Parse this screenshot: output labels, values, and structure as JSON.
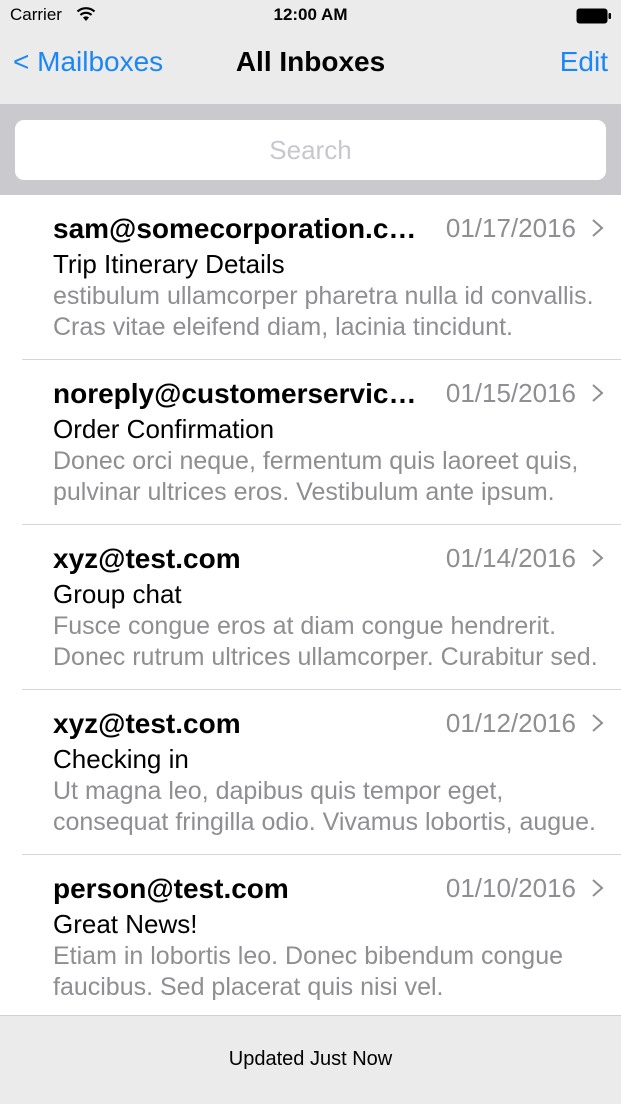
{
  "status_bar": {
    "carrier": "Carrier",
    "time": "12:00 AM",
    "wifi_icon": "wifi-icon",
    "battery_icon": "battery-icon"
  },
  "nav": {
    "back_label": "< Mailboxes",
    "title": "All Inboxes",
    "edit_label": "Edit",
    "accent_color": "#1a87f5"
  },
  "search": {
    "placeholder": "Search",
    "value": ""
  },
  "messages": [
    {
      "sender": "sam@somecorporation.com",
      "date": "01/17/2016",
      "subject": "Trip Itinerary Details",
      "preview": "estibulum ullamcorper pharetra nulla id convallis. Cras vitae eleifend diam, lacinia tincidunt."
    },
    {
      "sender": "noreply@customerservice.com",
      "date": "01/15/2016",
      "subject": "Order Confirmation",
      "preview": "Donec orci neque, fermentum quis laoreet quis, pulvinar ultrices eros. Vestibulum ante ipsum."
    },
    {
      "sender": "xyz@test.com",
      "date": "01/14/2016",
      "subject": "Group chat",
      "preview": "Fusce congue eros at diam congue hendrerit. Donec rutrum ultrices ullamcorper. Curabitur sed."
    },
    {
      "sender": "xyz@test.com",
      "date": "01/12/2016",
      "subject": "Checking in",
      "preview": "Ut magna leo, dapibus quis tempor eget, consequat fringilla odio. Vivamus lobortis, augue."
    },
    {
      "sender": "person@test.com",
      "date": "01/10/2016",
      "subject": "Great News!",
      "preview": "Etiam in lobortis leo. Donec bibendum congue faucibus. Sed placerat quis nisi vel."
    }
  ],
  "toolbar": {
    "status": "Updated Just Now"
  }
}
